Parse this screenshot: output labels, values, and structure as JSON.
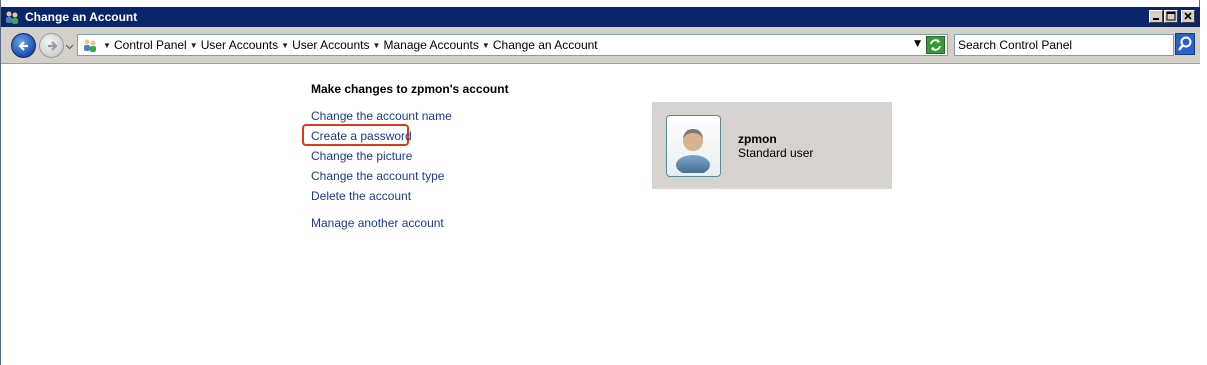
{
  "window": {
    "title": "Change an Account",
    "controls": {
      "minimize": "minimize-icon",
      "maximize": "maximize-icon",
      "close": "close-icon"
    }
  },
  "address_bar": {
    "breadcrumbs": [
      "Control Panel",
      "User Accounts",
      "User Accounts",
      "Manage Accounts",
      "Change an Account"
    ]
  },
  "search": {
    "placeholder": "Search Control Panel"
  },
  "main": {
    "heading": "Make changes to zpmon's account",
    "links": {
      "change_name": "Change the account name",
      "create_password": "Create a password",
      "change_picture": "Change the picture",
      "change_type": "Change the account type",
      "delete": "Delete the account",
      "manage_another": "Manage another account"
    }
  },
  "user_card": {
    "name": "zpmon",
    "type": "Standard user"
  },
  "colors": {
    "title_bar": "#0a246a",
    "link": "#1c3b8c",
    "highlight": "#e03a1e",
    "user_card_bg": "#d6d3ce"
  }
}
